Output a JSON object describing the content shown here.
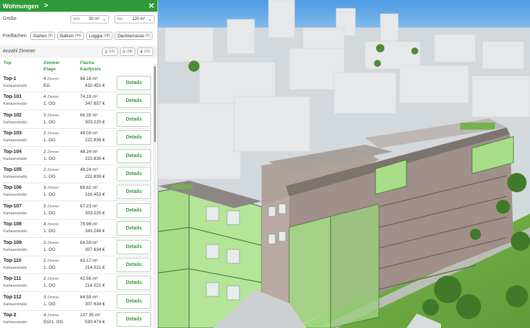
{
  "panel": {
    "title": "Wohnungen",
    "chevron": ">",
    "close": "✕"
  },
  "filters": {
    "size": {
      "label": "Größe",
      "from_prefix": "von",
      "from_value": "30 m²",
      "to_prefix": "bis",
      "to_value": "120 m²"
    },
    "outdoor": {
      "label": "Freiflächen",
      "chips": [
        {
          "label": "Garten",
          "count": "(6)"
        },
        {
          "label": "Balkon",
          "count": "(44)"
        },
        {
          "label": "Loggia",
          "count": "(28)"
        },
        {
          "label": "Dachterrasse",
          "count": "(5)"
        }
      ]
    },
    "rooms": {
      "label": "Anzahl Zimmer",
      "chips": [
        {
          "label": "2",
          "count": "(15)"
        },
        {
          "label": "3",
          "count": "(28)"
        },
        {
          "label": "4",
          "count": "(18)"
        }
      ]
    }
  },
  "table": {
    "col_top": "Top",
    "col_zimmer": "Zimmer",
    "col_etage": "Etage",
    "col_flaeche": "Fläche",
    "col_kaufpreis": "Kaufpreis",
    "details_label": "Details",
    "rows": [
      {
        "top": "Top-1",
        "street": "Karlauerstraße",
        "rooms": "4",
        "rooms_unit": "Zimmer",
        "floor": "EG",
        "area": "96.16 m²",
        "price": "432.451 €"
      },
      {
        "top": "Top-101",
        "street": "Karlauerstraße",
        "rooms": "4",
        "rooms_unit": "Zimmer",
        "floor": "1. OG",
        "area": "74.19 m²",
        "price": "347.657 €"
      },
      {
        "top": "Top-102",
        "street": "Karlauerstraße",
        "rooms": "3",
        "rooms_unit": "Zimmer",
        "floor": "1. OG",
        "area": "66.35 m²",
        "price": "303.225 €"
      },
      {
        "top": "Top-103",
        "street": "Karlauerstraße",
        "rooms": "2",
        "rooms_unit": "Zimmer",
        "floor": "1. OG",
        "area": "49.09 m²",
        "price": "222.839 €"
      },
      {
        "top": "Top-104",
        "street": "Karlauerstraße",
        "rooms": "2",
        "rooms_unit": "Zimmer",
        "floor": "1. OG",
        "area": "48.24 m²",
        "price": "222.839 €"
      },
      {
        "top": "Top-105",
        "street": "Karlauerstraße",
        "rooms": "2",
        "rooms_unit": "Zimmer",
        "floor": "1. OG",
        "area": "48.24 m²",
        "price": "222.839 €"
      },
      {
        "top": "Top-106",
        "street": "Karlauerstraße",
        "rooms": "3",
        "rooms_unit": "Zimmer",
        "floor": "1. OG",
        "area": "69.62 m²",
        "price": "316.453 €"
      },
      {
        "top": "Top-107",
        "street": "Karlauerstraße",
        "rooms": "3",
        "rooms_unit": "Zimmer",
        "floor": "1. OG",
        "area": "67.23 m²",
        "price": "303.225 €"
      },
      {
        "top": "Top-108",
        "street": "Karlauerstraße",
        "rooms": "4",
        "rooms_unit": "Zimmer",
        "floor": "1. OG",
        "area": "75.98 m²",
        "price": "343.248 €"
      },
      {
        "top": "Top-109",
        "street": "Karlauerstraße",
        "rooms": "3",
        "rooms_unit": "Zimmer",
        "floor": "1. OG",
        "area": "64.59 m²",
        "price": "307.634 €"
      },
      {
        "top": "Top-110",
        "street": "Karlauerstraße",
        "rooms": "2",
        "rooms_unit": "Zimmer",
        "floor": "1. OG",
        "area": "43.17 m²",
        "price": "214.021 €"
      },
      {
        "top": "Top-111",
        "street": "Karlauerstraße",
        "rooms": "2",
        "rooms_unit": "Zimmer",
        "floor": "1. OG",
        "area": "42.56 m²",
        "price": "214.021 €"
      },
      {
        "top": "Top-112",
        "street": "Karlauerstraße",
        "rooms": "3",
        "rooms_unit": "Zimmer",
        "floor": "1. OG",
        "area": "64.59 m²",
        "price": "307.634 €"
      },
      {
        "top": "Top-2",
        "street": "Karlauerstraße",
        "rooms": "4",
        "rooms_unit": "Zimmer",
        "floor": "EG/1. OG",
        "area": "107.35 m²",
        "price": "530.474 €"
      }
    ]
  },
  "colors": {
    "accent": "#2e9a3a",
    "highlight_facade": "#9ad878",
    "sky": "#5fa6e8"
  }
}
